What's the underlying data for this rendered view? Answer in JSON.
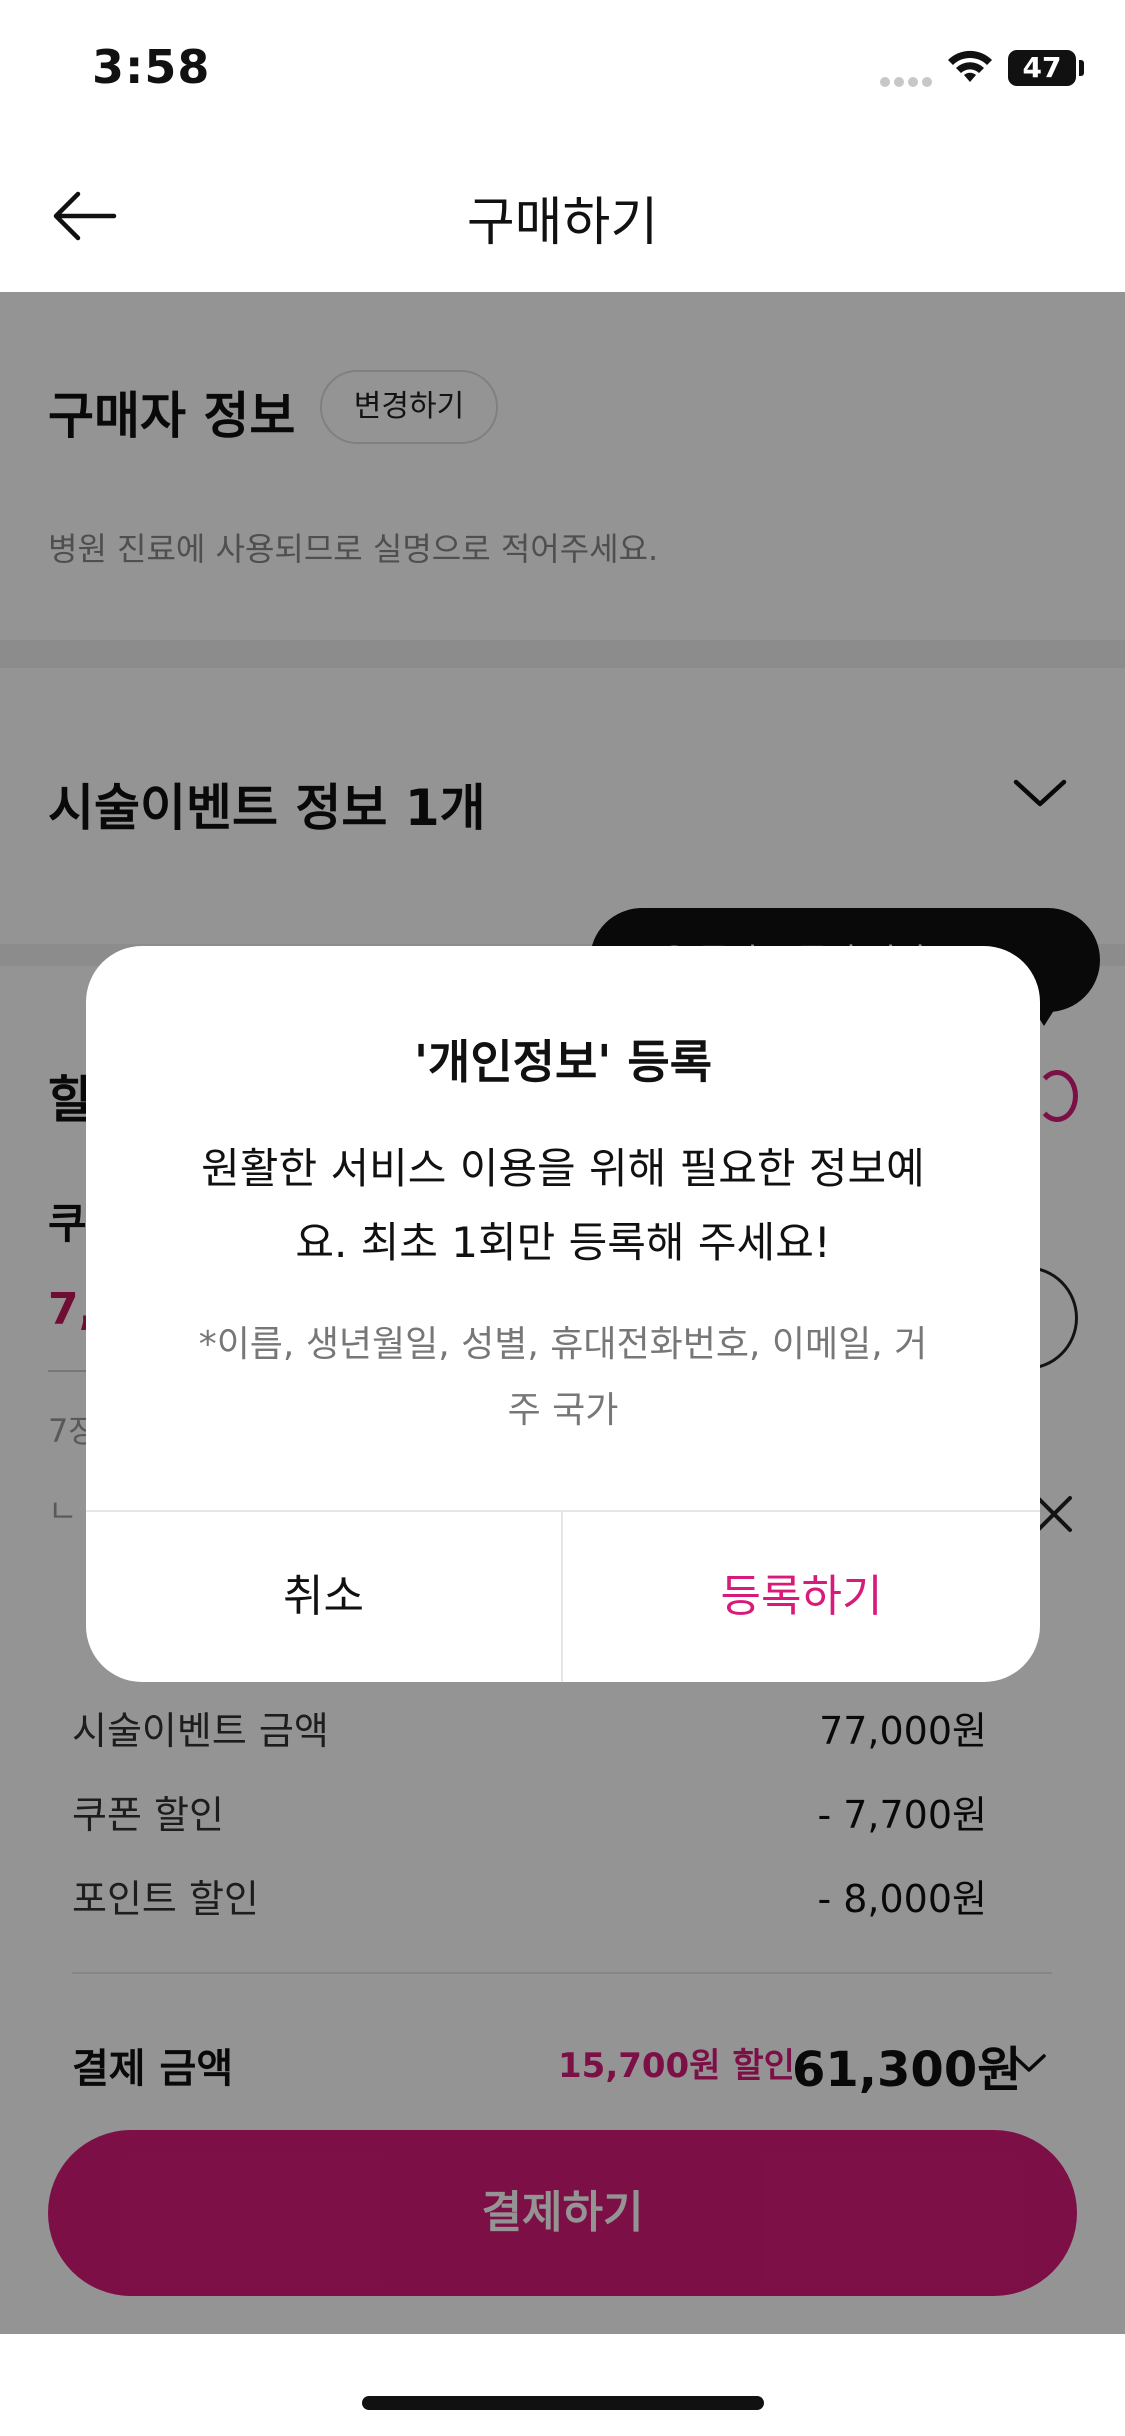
{
  "status_bar": {
    "time": "3:58",
    "battery": "47"
  },
  "nav": {
    "title": "구매하기"
  },
  "buyer": {
    "title": "구매자 정보",
    "change_label": "변경하기",
    "description": "병원 진료에 사용되므로 실명으로 적어주세요."
  },
  "event": {
    "title": "시술이벤트 정보 1개"
  },
  "discount": {
    "title": "할",
    "coupon_label": "쿠",
    "coupon_amount": "7,",
    "coupon_note": "7장",
    "coupon_note2": "ㄴ"
  },
  "tooltip": {
    "text": "보유 중인 쿠폰이 있어요!"
  },
  "summary": {
    "rows": [
      {
        "label": "시술이벤트 금액",
        "value": "77,000원"
      },
      {
        "label": "쿠폰 할인",
        "value": "- 7,700원"
      },
      {
        "label": "포인트 할인",
        "value": "- 8,000원"
      }
    ],
    "pay_label": "결제 금액",
    "pay_discount": "15,700원 할인",
    "pay_total": "61,300원",
    "pay_button": "결제하기"
  },
  "modal": {
    "title": "'개인정보' 등록",
    "body_line1": "원활한 서비스 이용을 위해 필요한 정보예",
    "body_line2": "요. 최초 1회만 등록해 주세요!",
    "note_line1": "*이름, 생년월일, 성별, 휴대전화번호, 이메일, 거",
    "note_line2": "주 국가",
    "cancel": "취소",
    "register": "등록하기"
  },
  "colors": {
    "accent": "#d81b7a"
  }
}
